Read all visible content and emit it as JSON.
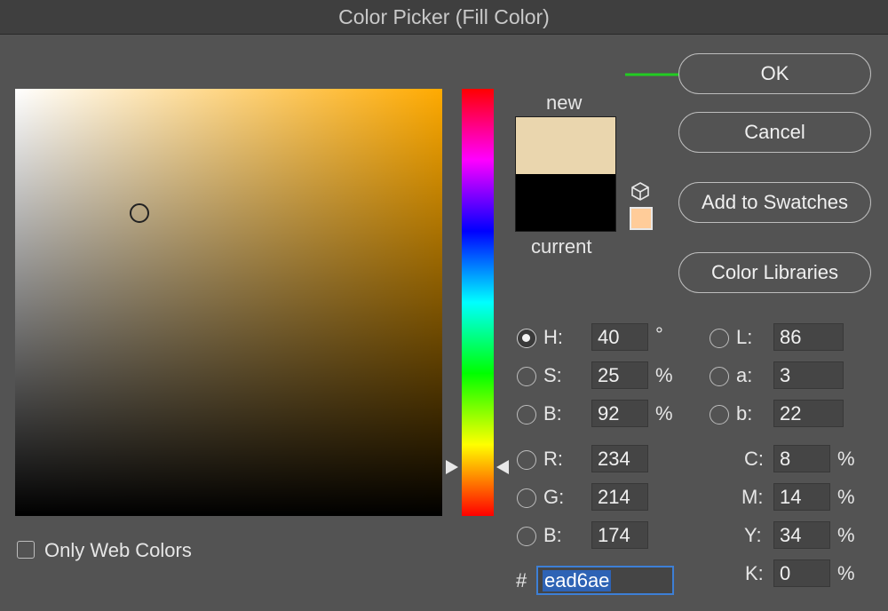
{
  "window": {
    "title": "Color Picker (Fill Color)"
  },
  "preview": {
    "new_label": "new",
    "current_label": "current",
    "new_color": "#ead6ae",
    "current_color": "#000000",
    "websafe_color": "#ffcc99"
  },
  "buttons": {
    "ok": "OK",
    "cancel": "Cancel",
    "add_swatches": "Add to Swatches",
    "color_libraries": "Color Libraries"
  },
  "accent": {
    "arrow_color": "#22cc22",
    "selection_color": "#2e63b5"
  },
  "fields": {
    "hsb": [
      {
        "label": "H:",
        "value": "40",
        "unit": "°",
        "selected": true
      },
      {
        "label": "S:",
        "value": "25",
        "unit": "%",
        "selected": false
      },
      {
        "label": "B:",
        "value": "92",
        "unit": "%",
        "selected": false
      }
    ],
    "rgb": [
      {
        "label": "R:",
        "value": "234"
      },
      {
        "label": "G:",
        "value": "214"
      },
      {
        "label": "B:",
        "value": "174"
      }
    ],
    "lab": [
      {
        "label": "L:",
        "value": "86"
      },
      {
        "label": "a:",
        "value": "3"
      },
      {
        "label": "b:",
        "value": "22"
      }
    ],
    "cmyk": [
      {
        "label": "C:",
        "value": "8",
        "unit": "%"
      },
      {
        "label": "M:",
        "value": "14",
        "unit": "%"
      },
      {
        "label": "Y:",
        "value": "34",
        "unit": "%"
      },
      {
        "label": "K:",
        "value": "0",
        "unit": "%"
      }
    ],
    "hex_prefix": "#",
    "hex_value": "ead6ae"
  },
  "options": {
    "only_web_colors": "Only Web Colors",
    "only_web_colors_checked": false
  }
}
